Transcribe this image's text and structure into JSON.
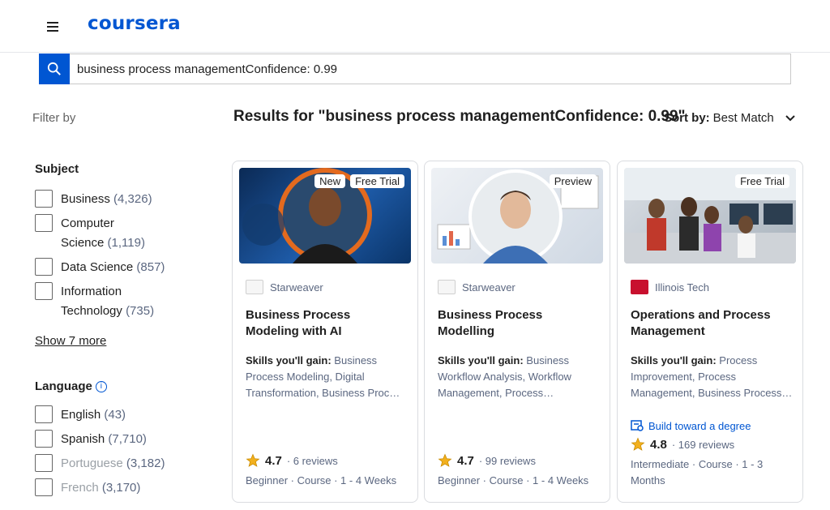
{
  "header": {
    "logo": "coursera"
  },
  "search": {
    "value": "business process managementConfidence: 0.99"
  },
  "filters": {
    "filter_by": "Filter by",
    "subject": {
      "title": "Subject",
      "options": [
        {
          "label": "Business",
          "count": "(4,326)"
        },
        {
          "label": "Computer Science",
          "count": "(1,119)"
        },
        {
          "label": "Data Science",
          "count": "(857)"
        },
        {
          "label": "Information Technology",
          "count": "(735)"
        }
      ],
      "show_more": "Show 7 more"
    },
    "language": {
      "title": "Language",
      "info": "i",
      "options": [
        {
          "label": "English",
          "count": "(43)"
        },
        {
          "label": "Spanish",
          "count": "(7,710)"
        },
        {
          "label": "Portuguese",
          "count": "(3,182)"
        },
        {
          "label": "French",
          "count": "(3,170)"
        }
      ]
    }
  },
  "results": {
    "title": "Results for \"business process managementConfidence: 0.99\"",
    "sort_label": "Sort by:",
    "sort_value": "Best Match"
  },
  "cards": [
    {
      "badges": [
        "New",
        "Free Trial"
      ],
      "partner": "Starweaver",
      "title": "Business Process Modeling with AI",
      "skills_label": "Skills you'll gain:",
      "skills": "Business Process Modeling, Digital Transformation, Business Proc…",
      "rating": "4.7",
      "reviews": "· 6 reviews",
      "meta": "Beginner · Course · 1 - 4 Weeks"
    },
    {
      "badges": [
        "Preview"
      ],
      "partner": "Starweaver",
      "title": "Business Process Modelling",
      "skills_label": "Skills you'll gain:",
      "skills": "Business Workflow Analysis, Workflow Management, Process…",
      "rating": "4.7",
      "reviews": "· 99 reviews",
      "meta": "Beginner · Course · 1 - 4 Weeks"
    },
    {
      "badges": [
        "Free Trial"
      ],
      "partner": "Illinois Tech",
      "title": "Operations and Process Management",
      "skills_label": "Skills you'll gain:",
      "skills": "Process Improvement, Process Management, Business Process…",
      "degree": "Build toward a degree",
      "rating": "4.8",
      "reviews": "· 169 reviews",
      "meta": "Intermediate · Course · 1 - 3 Months"
    }
  ],
  "colors": {
    "brand": "#0056d2",
    "star": "#f2b01e",
    "text_muted": "#5b6780"
  },
  "icons": {
    "menu": "hamburger-icon",
    "search": "search-icon",
    "sort": "chevron-down-icon",
    "star": "star-icon",
    "degree": "degree-icon"
  }
}
